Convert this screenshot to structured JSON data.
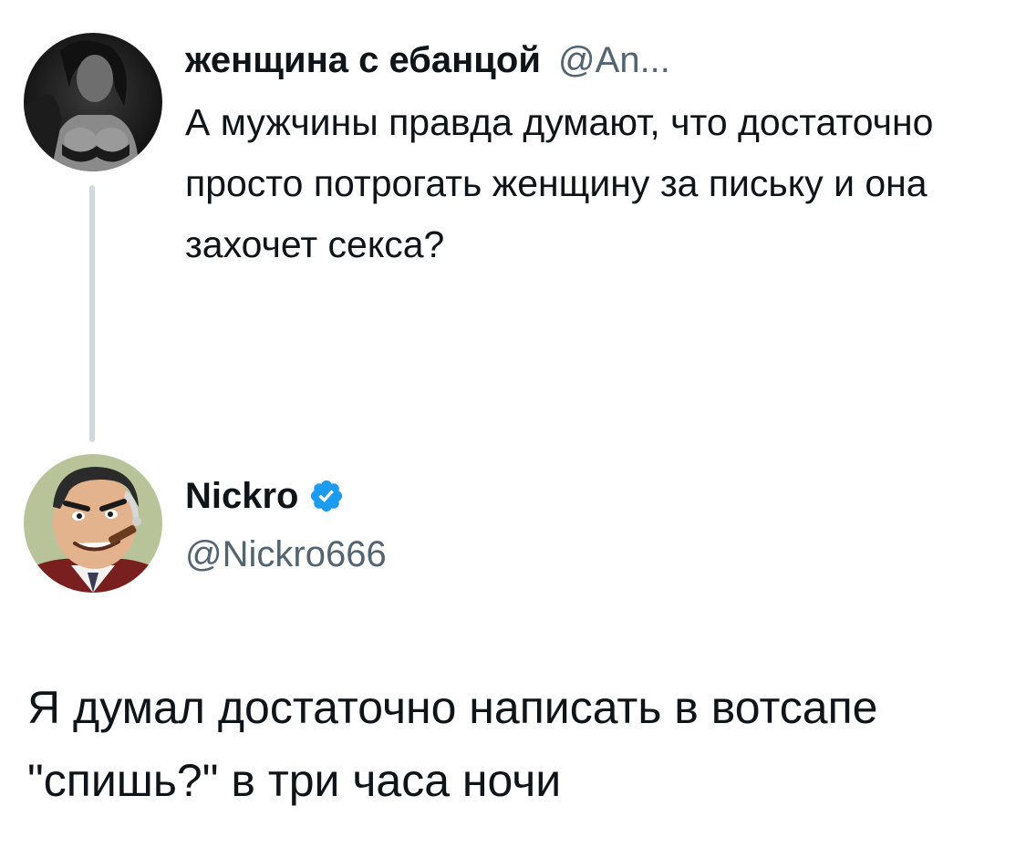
{
  "original_tweet": {
    "display_name": "женщина с ебанцой",
    "handle": "@An...",
    "avatar": "woman-in-lingerie-avatar",
    "text": "А мужчины правда думают, что достаточно просто потрогать женщину за письку и она захочет секса?"
  },
  "reply_tweet": {
    "display_name": "Nickro",
    "verified": true,
    "verified_icon": "verified-badge-icon",
    "handle": "@Nickro666",
    "avatar": "cartoon-man-with-cigar-avatar",
    "text": "Я думал достаточно написать в вотсапе \"спишь?\" в три часа ночи"
  },
  "colors": {
    "text_primary": "#0f1419",
    "text_secondary": "#536471",
    "thread_line": "#cfd9de",
    "verified_blue": "#1d9bf0",
    "background": "#ffffff"
  }
}
